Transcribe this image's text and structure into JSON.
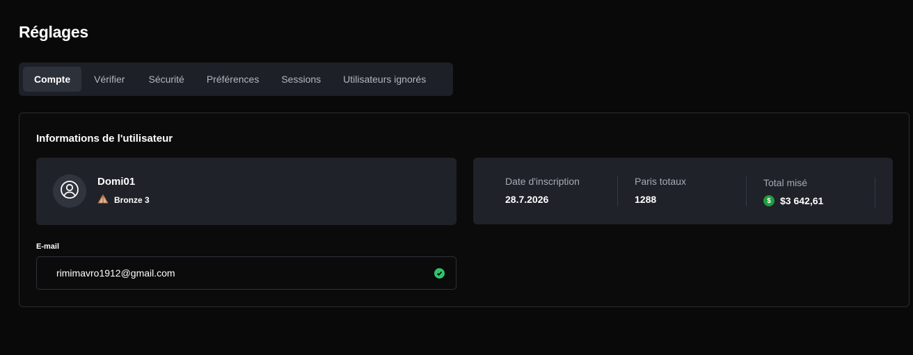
{
  "page": {
    "title": "Réglages"
  },
  "tabs": [
    {
      "label": "Compte",
      "active": true
    },
    {
      "label": "Vérifier",
      "active": false
    },
    {
      "label": "Sécurité",
      "active": false
    },
    {
      "label": "Préférences",
      "active": false
    },
    {
      "label": "Sessions",
      "active": false
    },
    {
      "label": "Utilisateurs ignorés",
      "active": false
    }
  ],
  "user_info": {
    "section_title": "Informations de l'utilisateur",
    "username": "Domi01",
    "rank": "Bronze 3",
    "avatar_icon": "user-circle-icon",
    "rank_icon": "bronze-rank-icon"
  },
  "stats": {
    "registration": {
      "label": "Date d'inscription",
      "value": "28.7.2026"
    },
    "total_bets": {
      "label": "Paris totaux",
      "value": "1288"
    },
    "total_wagered": {
      "label": "Total misé",
      "value": "$3 642,61",
      "currency_icon": "dollar-coin-icon"
    }
  },
  "email": {
    "label": "E-mail",
    "value": "rimimavro1912@gmail.com",
    "verified_icon": "check-circle-icon"
  },
  "colors": {
    "background": "#090909",
    "panel": "#1f2229",
    "accent_green": "#2ec46b",
    "coin_green": "#1e9e3e",
    "bronze": "#c98a5d"
  }
}
